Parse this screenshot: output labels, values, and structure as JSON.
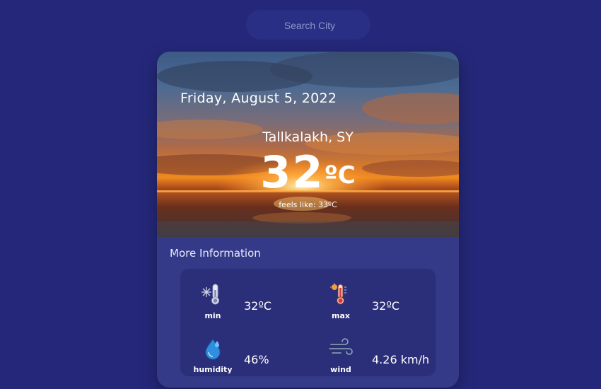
{
  "search": {
    "placeholder": "Search City"
  },
  "weather": {
    "date": "Friday, August 5, 2022",
    "location": "Tallkalakh, SY",
    "temperature": "32",
    "unit": "ºC",
    "feels_like": "feels like: 33ºC"
  },
  "more_info": {
    "title": "More Information",
    "items": [
      {
        "label": "min",
        "value": "32ºC",
        "icon": "thermometer-cold-icon"
      },
      {
        "label": "max",
        "value": "32ºC",
        "icon": "thermometer-hot-icon"
      },
      {
        "label": "humidity",
        "value": "46%",
        "icon": "humidity-drop-icon"
      },
      {
        "label": "wind",
        "value": "4.26 km/h",
        "icon": "wind-icon"
      }
    ]
  },
  "colors": {
    "background": "#25287a",
    "card": "#343a87",
    "info_box": "#2b2e78",
    "search_bg": "#2a2f86"
  }
}
